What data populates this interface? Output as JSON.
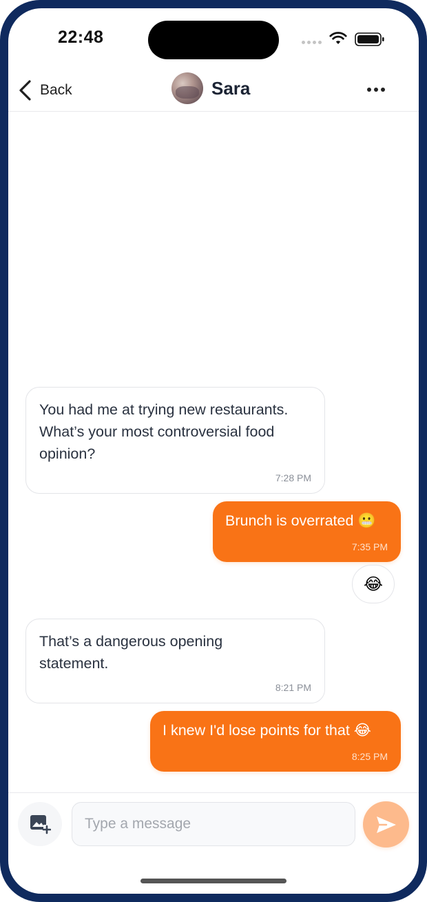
{
  "status_bar": {
    "time": "22:48",
    "icons": [
      "signal-icon",
      "wifi-icon",
      "battery-icon"
    ]
  },
  "header": {
    "back_label": "Back",
    "contact_name": "Sara",
    "icons": {
      "back": "chevron-left-icon",
      "more": "more-horizontal-icon",
      "avatar": "avatar"
    }
  },
  "messages": [
    {
      "direction": "incoming",
      "text_lines": [
        "You had me at trying new restaurants.",
        "What’s your most controversial food",
        "opinion?"
      ],
      "time": "7:28 PM"
    },
    {
      "direction": "outgoing",
      "text": "Brunch is overrated 😬",
      "time": "7:35 PM",
      "reaction": "😂"
    },
    {
      "direction": "incoming",
      "text_lines": [
        "That’s a dangerous opening",
        "statement."
      ],
      "time": "8:21 PM"
    },
    {
      "direction": "outgoing",
      "text": "I knew I'd lose points for that 😂",
      "time": "8:25 PM"
    }
  ],
  "composer": {
    "placeholder": "Type a message",
    "value": "",
    "icons": {
      "attach": "add-image-icon",
      "send": "send-icon"
    }
  },
  "colors": {
    "frame": "#0f2a5e",
    "accent": "#f97316",
    "send_button": "#fdba8c",
    "incoming_border": "#e3e4e8"
  }
}
